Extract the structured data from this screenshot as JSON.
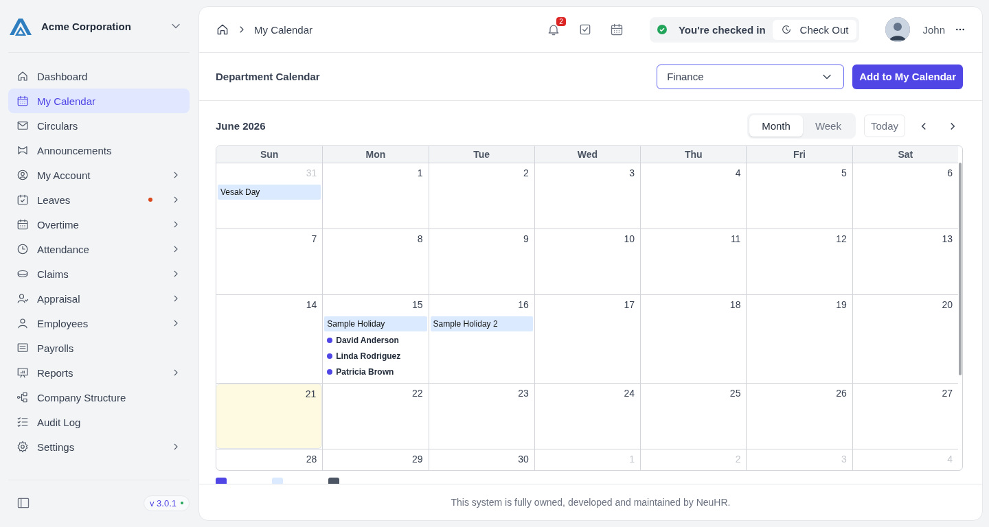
{
  "sidebar": {
    "company": "Acme Corporation",
    "items": [
      {
        "label": "Dashboard",
        "selected": false,
        "submenu": false,
        "alert": false
      },
      {
        "label": "My Calendar",
        "selected": true,
        "submenu": false,
        "alert": false
      },
      {
        "label": "Circulars",
        "selected": false,
        "submenu": false,
        "alert": false
      },
      {
        "label": "Announcements",
        "selected": false,
        "submenu": false,
        "alert": false
      },
      {
        "label": "My Account",
        "selected": false,
        "submenu": true,
        "alert": false
      },
      {
        "label": "Leaves",
        "selected": false,
        "submenu": true,
        "alert": true
      },
      {
        "label": "Overtime",
        "selected": false,
        "submenu": true,
        "alert": false
      },
      {
        "label": "Attendance",
        "selected": false,
        "submenu": true,
        "alert": false
      },
      {
        "label": "Claims",
        "selected": false,
        "submenu": true,
        "alert": false
      },
      {
        "label": "Appraisal",
        "selected": false,
        "submenu": true,
        "alert": false
      },
      {
        "label": "Employees",
        "selected": false,
        "submenu": true,
        "alert": false
      },
      {
        "label": "Payrolls",
        "selected": false,
        "submenu": false,
        "alert": false
      },
      {
        "label": "Reports",
        "selected": false,
        "submenu": true,
        "alert": false
      },
      {
        "label": "Company Structure",
        "selected": false,
        "submenu": false,
        "alert": false
      },
      {
        "label": "Audit Log",
        "selected": false,
        "submenu": false,
        "alert": false
      },
      {
        "label": "Settings",
        "selected": false,
        "submenu": true,
        "alert": false
      }
    ],
    "version": "v 3.0.1"
  },
  "header": {
    "breadcrumb": "My Calendar",
    "notifications": "2",
    "status": "You're checked in",
    "check_out": "Check Out",
    "user": "John"
  },
  "toolbar": {
    "title": "Department Calendar",
    "department": "Finance",
    "add_button": "Add to My Calendar"
  },
  "calendar": {
    "title": "June 2026",
    "views": [
      {
        "label": "Month",
        "selected": true
      },
      {
        "label": "Week",
        "selected": false
      }
    ],
    "today_button": "Today",
    "weekdays": [
      "Sun",
      "Mon",
      "Tue",
      "Wed",
      "Thu",
      "Fri",
      "Sat"
    ],
    "weeks": [
      [
        {
          "day": "31",
          "muted": true,
          "today": false,
          "events": [
            {
              "kind": "holiday",
              "label": "Vesak Day"
            }
          ]
        },
        {
          "day": "1",
          "muted": false,
          "today": false
        },
        {
          "day": "2",
          "muted": false,
          "today": false
        },
        {
          "day": "3",
          "muted": false,
          "today": false
        },
        {
          "day": "4",
          "muted": false,
          "today": false
        },
        {
          "day": "5",
          "muted": false,
          "today": false
        },
        {
          "day": "6",
          "muted": false,
          "today": false
        }
      ],
      [
        {
          "day": "7",
          "muted": false,
          "today": false
        },
        {
          "day": "8",
          "muted": false,
          "today": false
        },
        {
          "day": "9",
          "muted": false,
          "today": false
        },
        {
          "day": "10",
          "muted": false,
          "today": false
        },
        {
          "day": "11",
          "muted": false,
          "today": false
        },
        {
          "day": "12",
          "muted": false,
          "today": false
        },
        {
          "day": "13",
          "muted": false,
          "today": false
        }
      ],
      [
        {
          "day": "14",
          "muted": false,
          "today": false
        },
        {
          "day": "15",
          "muted": false,
          "today": false,
          "events": [
            {
              "kind": "holiday",
              "label": "Sample Holiday"
            },
            {
              "kind": "leave",
              "label": "David Anderson"
            },
            {
              "kind": "leave",
              "label": "Linda Rodriguez"
            },
            {
              "kind": "leave",
              "label": "Patricia Brown"
            }
          ]
        },
        {
          "day": "16",
          "muted": false,
          "today": false,
          "events": [
            {
              "kind": "holiday",
              "label": "Sample Holiday 2"
            }
          ]
        },
        {
          "day": "17",
          "muted": false,
          "today": false
        },
        {
          "day": "18",
          "muted": false,
          "today": false
        },
        {
          "day": "19",
          "muted": false,
          "today": false
        },
        {
          "day": "20",
          "muted": false,
          "today": false
        }
      ],
      [
        {
          "day": "21",
          "muted": false,
          "today": true
        },
        {
          "day": "22",
          "muted": false,
          "today": false
        },
        {
          "day": "23",
          "muted": false,
          "today": false
        },
        {
          "day": "24",
          "muted": false,
          "today": false
        },
        {
          "day": "25",
          "muted": false,
          "today": false
        },
        {
          "day": "26",
          "muted": false,
          "today": false
        },
        {
          "day": "27",
          "muted": false,
          "today": false
        }
      ],
      [
        {
          "day": "28",
          "muted": false,
          "today": false
        },
        {
          "day": "29",
          "muted": false,
          "today": false
        },
        {
          "day": "30",
          "muted": false,
          "today": false
        },
        {
          "day": "1",
          "muted": true,
          "today": false
        },
        {
          "day": "2",
          "muted": true,
          "today": false
        },
        {
          "day": "3",
          "muted": true,
          "today": false
        },
        {
          "day": "4",
          "muted": true,
          "today": false
        }
      ]
    ],
    "legend": [
      {
        "color": "#4f46e5"
      },
      {
        "color": "#dbeafe"
      },
      {
        "color": "#4b5563"
      }
    ]
  },
  "footer": "This system is fully owned, developed and maintained by NeuHR."
}
